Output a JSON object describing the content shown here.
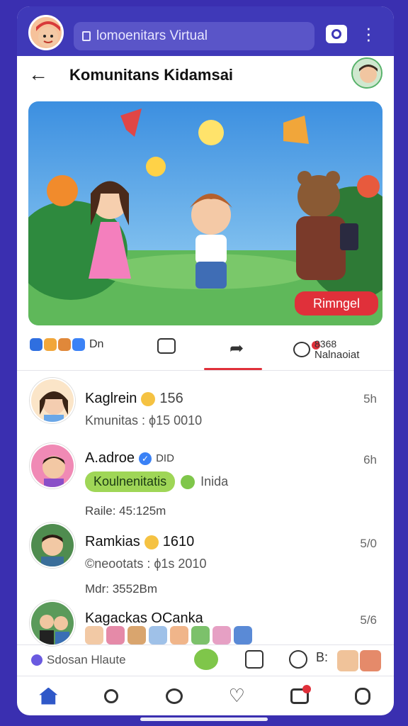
{
  "app": {
    "search_placeholder": "lomoenitars Virtual"
  },
  "header": {
    "title": "Komunitans Kidamsai"
  },
  "hero": {
    "cta": "Rimngel"
  },
  "actions": {
    "reaction_count": "Dn",
    "comment_count": "8368",
    "comment_label": "Nalnaoiat"
  },
  "feed": [
    {
      "name": "Kaglrein",
      "score": "156",
      "sub": "Kmunitas : ϕ15 0010",
      "time": "5h"
    },
    {
      "name": "A.adroe",
      "score": "DID",
      "pill": "Koulnenitatis",
      "extra": "Inida",
      "time": "6h"
    },
    {
      "meta": "Raile: 45:125m",
      "name": "Ramkias",
      "score": "1610",
      "sub": "©neootats : ϕ1s 2010",
      "time": "5/0"
    },
    {
      "meta": "Mdr: 3552Bm",
      "name": "Kagackas OCanka",
      "time": "5/6"
    }
  ],
  "composer": {
    "label": "Sdosan Hlaute",
    "aux": "B:"
  },
  "colors": {
    "primary": "#3f39b8",
    "accent": "#e0303a",
    "pill": "#9fd657"
  }
}
